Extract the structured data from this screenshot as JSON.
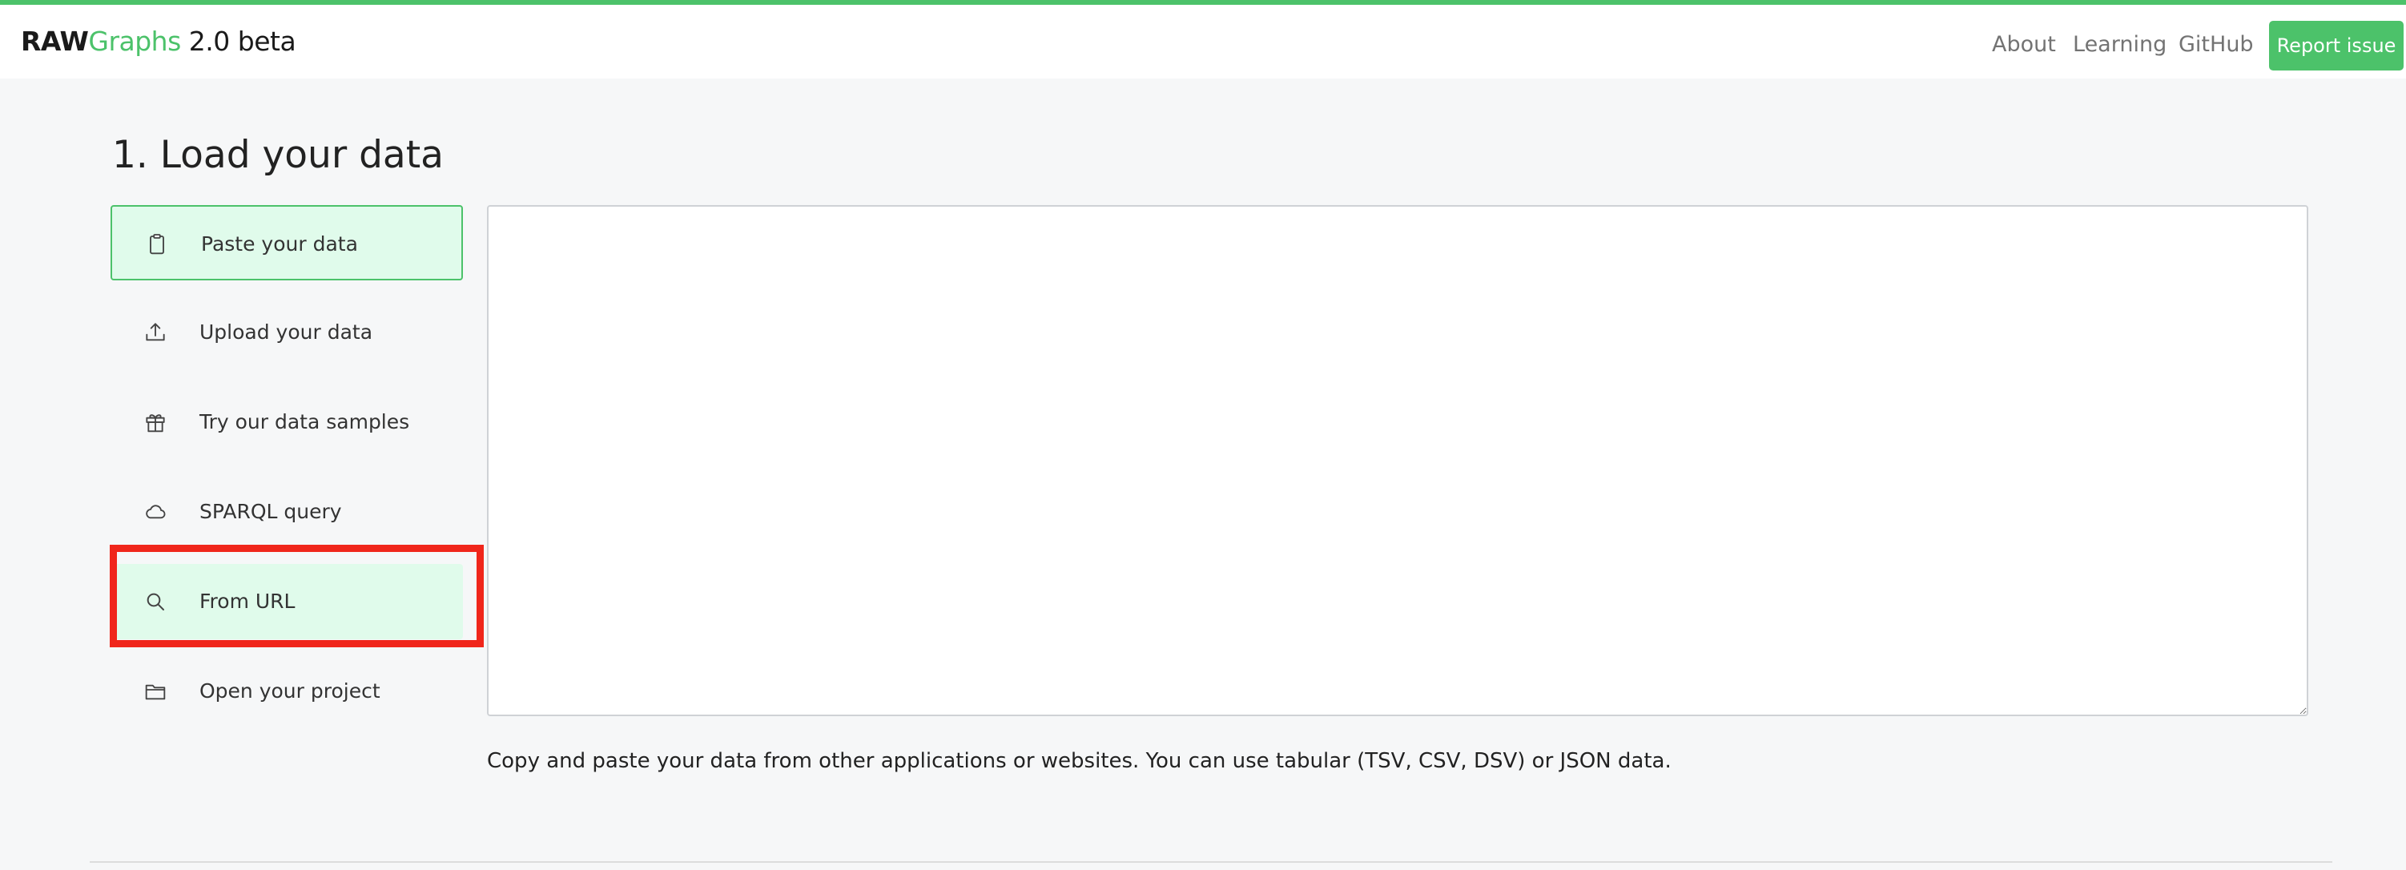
{
  "header": {
    "brand": {
      "raw": "RAW",
      "graphs": "Graphs",
      "version": " 2.0 beta"
    },
    "nav": [
      "About",
      "Learning",
      "GitHub"
    ],
    "report_button": "Report issue"
  },
  "main": {
    "title": "1. Load your data",
    "sources": [
      {
        "label": "Paste your data",
        "icon": "clipboard-icon",
        "state": "selected"
      },
      {
        "label": "Upload your data",
        "icon": "upload-icon",
        "state": "default"
      },
      {
        "label": "Try our data samples",
        "icon": "gift-icon",
        "state": "default"
      },
      {
        "label": "SPARQL query",
        "icon": "cloud-icon",
        "state": "default"
      },
      {
        "label": "From URL",
        "icon": "search-icon",
        "state": "hovered"
      },
      {
        "label": "Open your project",
        "icon": "folder-icon",
        "state": "default"
      }
    ],
    "paste_area_value": "",
    "help_text": "Copy and paste your data from other applications or websites. You can use tabular (TSV, CSV, DSV) or JSON data."
  },
  "colors": {
    "accent": "#4cc26a",
    "selected_background": "#e0fbeb",
    "annotation_outline": "#f0261b",
    "page_background": "#f6f7f8"
  }
}
